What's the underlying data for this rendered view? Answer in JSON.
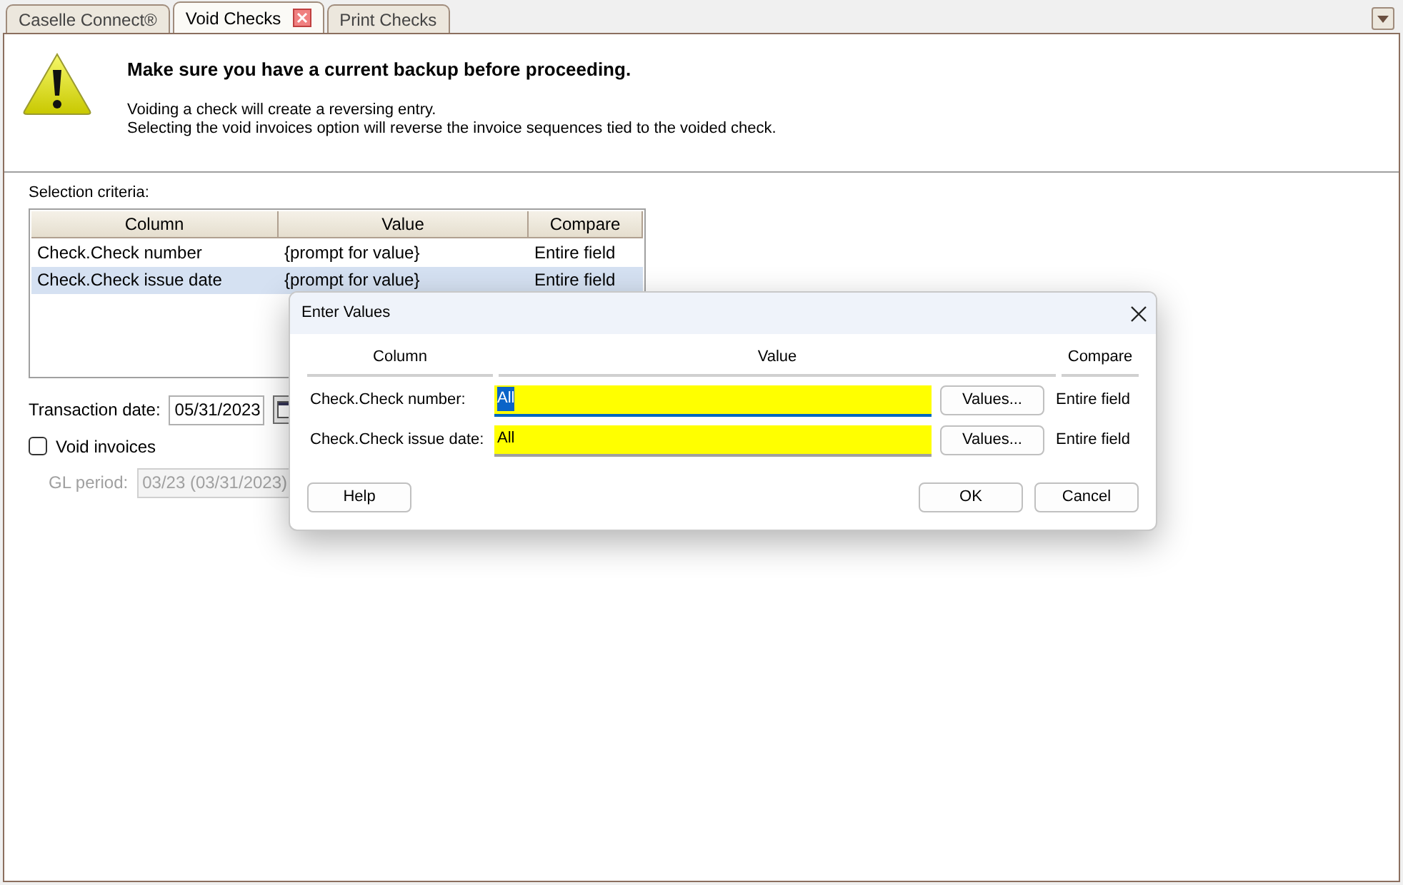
{
  "tabs": [
    {
      "label": "Caselle Connect®",
      "selected": false,
      "closable": false
    },
    {
      "label": "Void Checks",
      "selected": true,
      "closable": true
    },
    {
      "label": "Print Checks",
      "selected": false,
      "closable": false
    }
  ],
  "warning": {
    "title": "Make sure you have a current backup before proceeding.",
    "lines": [
      "Voiding a check will create a reversing entry.",
      "Selecting the void invoices option will reverse the invoice sequences tied to the voided check."
    ]
  },
  "criteria": {
    "label": "Selection criteria:",
    "columns": [
      "Column",
      "Value",
      "Compare"
    ],
    "rows": [
      {
        "cells": [
          "Check.Check number",
          "{prompt for value}",
          "Entire field"
        ],
        "selected": false
      },
      {
        "cells": [
          "Check.Check issue date",
          "{prompt for value}",
          "Entire field"
        ],
        "selected": true
      }
    ]
  },
  "transaction_date": {
    "label": "Transaction date:",
    "value": "05/31/2023"
  },
  "void_invoices": {
    "label": "Void invoices",
    "checked": false
  },
  "gl_period": {
    "label": "GL period:",
    "value": "03/23 (03/31/2023)",
    "disabled": true
  },
  "dialog": {
    "title": "Enter Values",
    "columns": [
      "Column",
      "Value",
      "Compare"
    ],
    "rows": [
      {
        "label": "Check.Check number:",
        "value": "All",
        "focused": true,
        "highlighted": true,
        "button": "Values...",
        "compare": "Entire field"
      },
      {
        "label": "Check.Check issue date:",
        "value": "All",
        "focused": false,
        "highlighted": true,
        "button": "Values...",
        "compare": "Entire field"
      }
    ],
    "buttons": {
      "help": "Help",
      "ok": "OK",
      "cancel": "Cancel"
    }
  }
}
